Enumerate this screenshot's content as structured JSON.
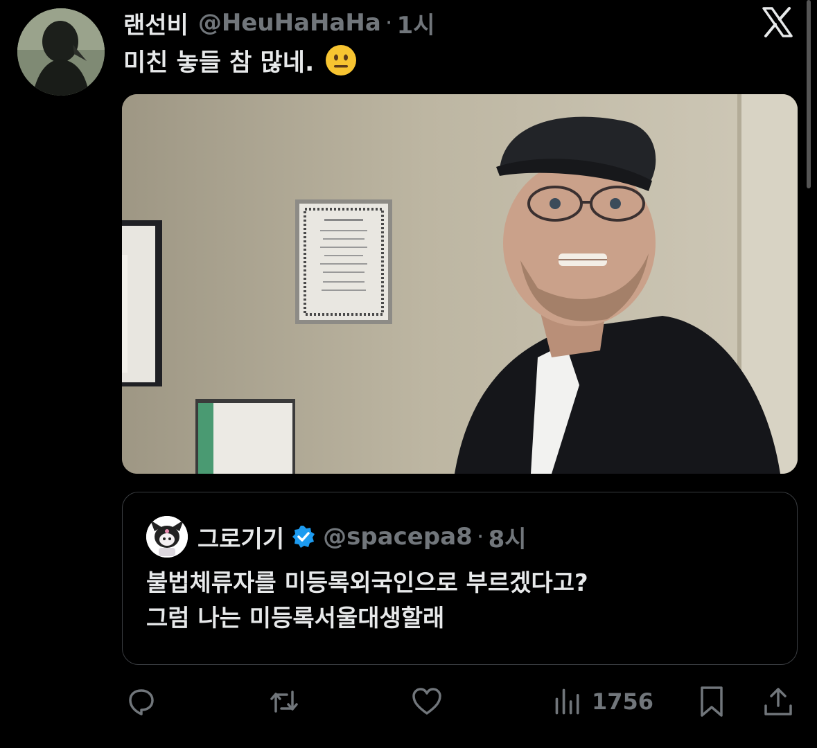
{
  "author": {
    "display_name": "랜선비",
    "handle": "@HeuHaHaHa",
    "separator": "·",
    "time": "1시"
  },
  "tweet": {
    "text": "미친 놓들 참 많네."
  },
  "icons": {
    "emoji": "neutral-face-emoji",
    "brand": "x-logo",
    "verified": "verified-badge"
  },
  "quoted_tweet": {
    "display_name": "그로기기",
    "handle": "@spacepa8",
    "separator": "·",
    "time": "8시",
    "lines": [
      "불법체류자를 미등록외국인으로 부르겠다고?",
      "그럼 나는 미등록서울대생할래"
    ]
  },
  "actions": {
    "views": "1756"
  },
  "colors": {
    "background": "#000000",
    "text": "#e7e9ea",
    "muted": "#71767b",
    "verified": "#1d9bf0",
    "border": "#3a3d41"
  }
}
